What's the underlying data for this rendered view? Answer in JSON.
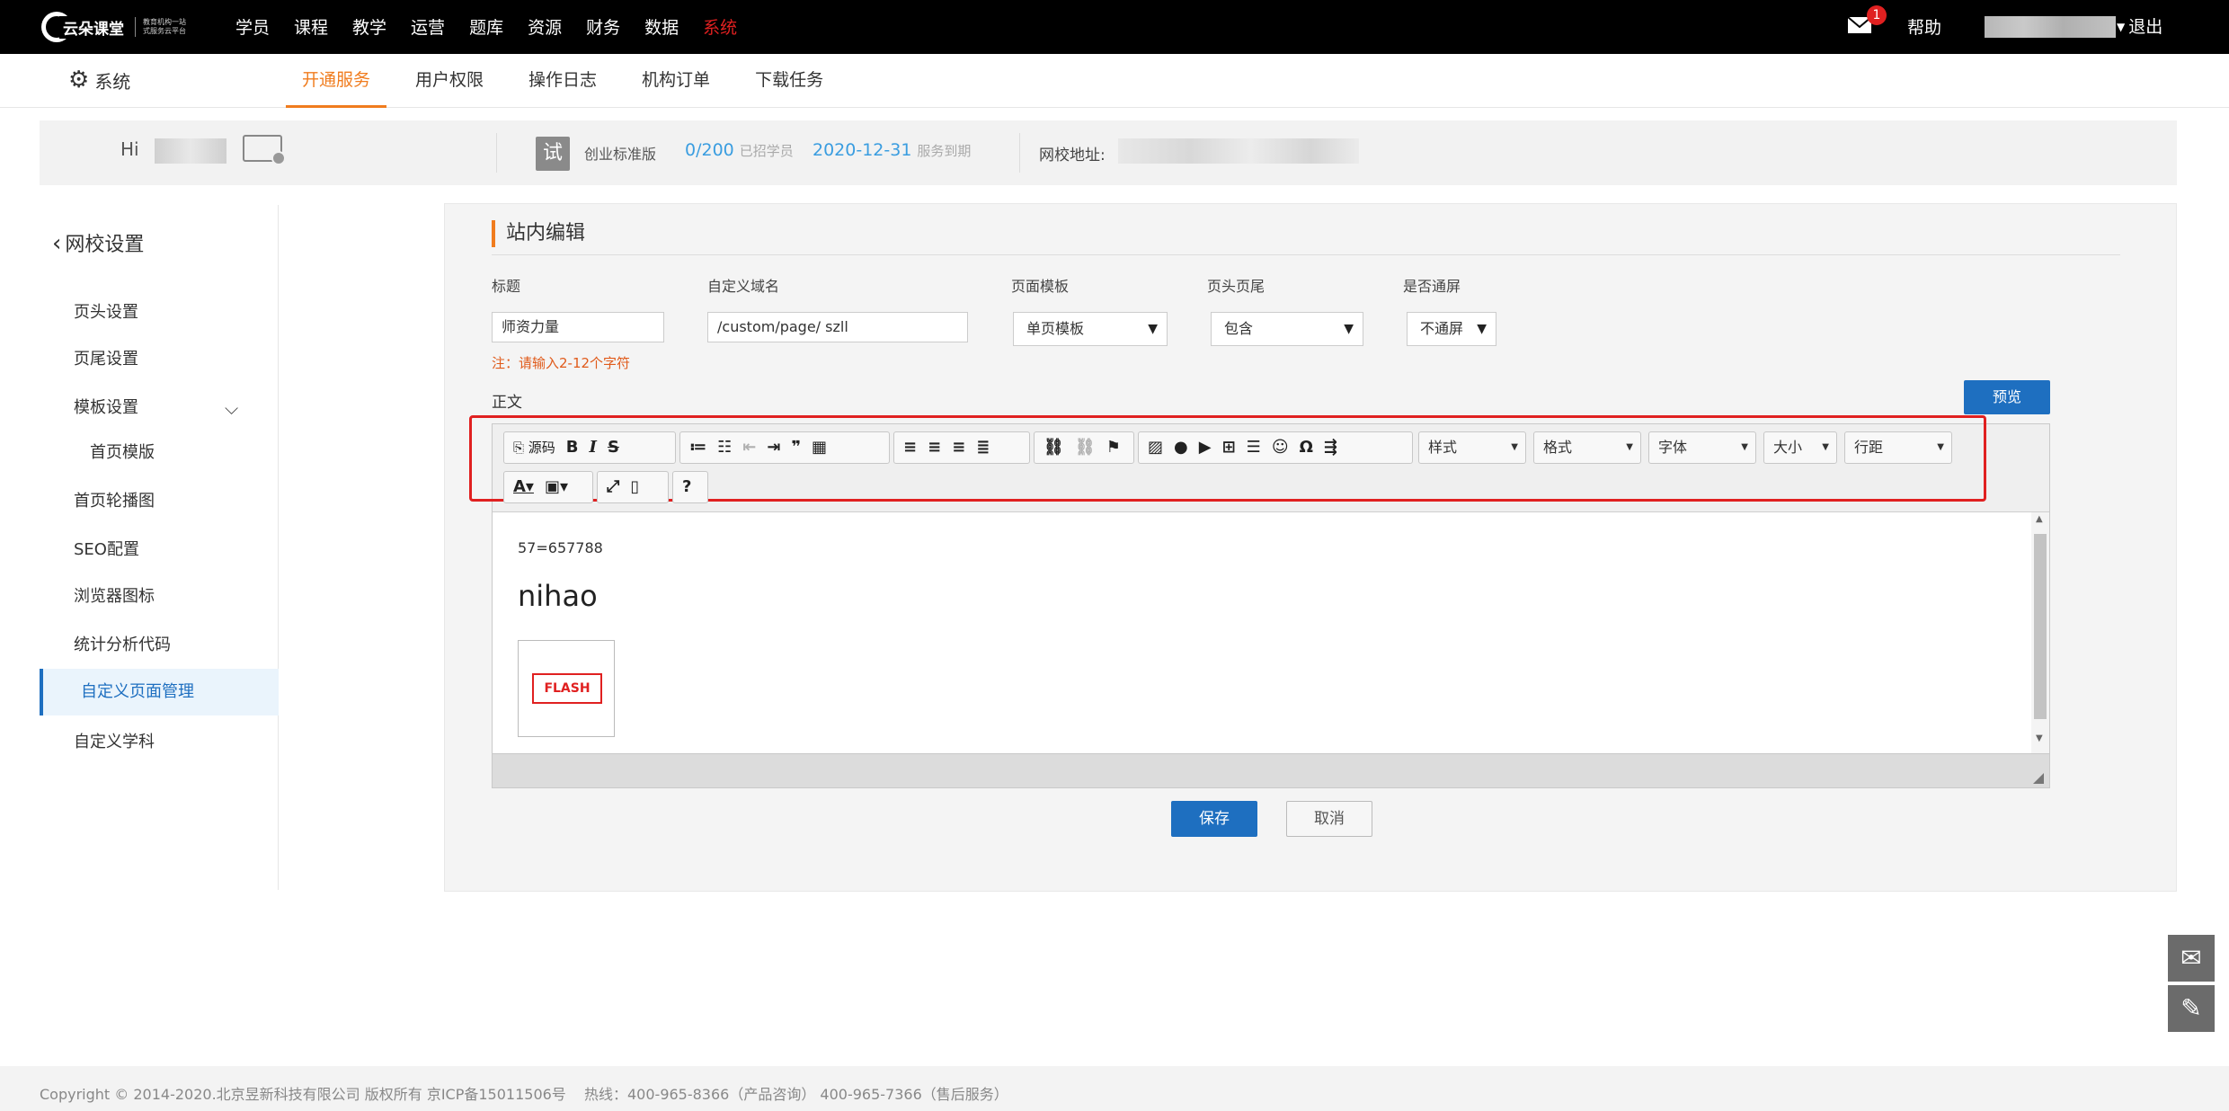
{
  "topbar": {
    "logo_name": "云朵课堂",
    "logo_slogan": "教育机构一站式服务云平台",
    "nav": [
      "学员",
      "课程",
      "教学",
      "运营",
      "题库",
      "资源",
      "财务",
      "数据",
      "系统"
    ],
    "active_nav": "系统",
    "mail_badge": "1",
    "help": "帮助",
    "logout": "退出"
  },
  "subbar": {
    "system_label": "系统",
    "tabs": [
      "开通服务",
      "用户权限",
      "操作日志",
      "机构订单",
      "下载任务"
    ]
  },
  "infobar": {
    "greeting": "Hi",
    "trial_badge": "试",
    "plan": "创业标准版",
    "students": "0/200",
    "students_label": "已招学员",
    "expire_date": "2020-12-31",
    "expire_label": "服务到期",
    "site_label": "网校地址:"
  },
  "sidebar": {
    "title": "网校设置",
    "items": [
      "页头设置",
      "页尾设置",
      "模板设置",
      "首页模版",
      "首页轮播图",
      "SEO配置",
      "浏览器图标",
      "统计分析代码",
      "自定义页面管理",
      "自定义学科"
    ],
    "active": "自定义页面管理"
  },
  "form": {
    "section_title": "站内编辑",
    "labels": {
      "title": "标题",
      "domain": "自定义域名",
      "template": "页面模板",
      "header_footer": "页头页尾",
      "fullscreen": "是否通屏"
    },
    "values": {
      "title": "师资力量",
      "domain": "/custom/page/ szll",
      "template": "单页模板",
      "header_footer": "包含",
      "fullscreen": "不通屏"
    },
    "note": "注：请输入2-12个字符",
    "body_label": "正文",
    "preview_button": "预览",
    "save_button": "保存",
    "cancel_button": "取消"
  },
  "editor": {
    "source_label": "源码",
    "combos": [
      "样式",
      "格式",
      "字体",
      "大小",
      "行距"
    ],
    "content_formula": "57=657788",
    "content_heading": "nihao",
    "flash_label": "FLASH"
  },
  "footer": {
    "copyright": "Copyright © 2014-2020.北京昱新科技有限公司 版权所有 京ICP备15011506号",
    "hotline": "热线：400-965-8366（产品咨询） 400-965-7366（售后服务）"
  },
  "colors": {
    "accent_orange": "#f07c1e",
    "primary_blue": "#1e6fc0",
    "highlight_red": "#e02020"
  }
}
